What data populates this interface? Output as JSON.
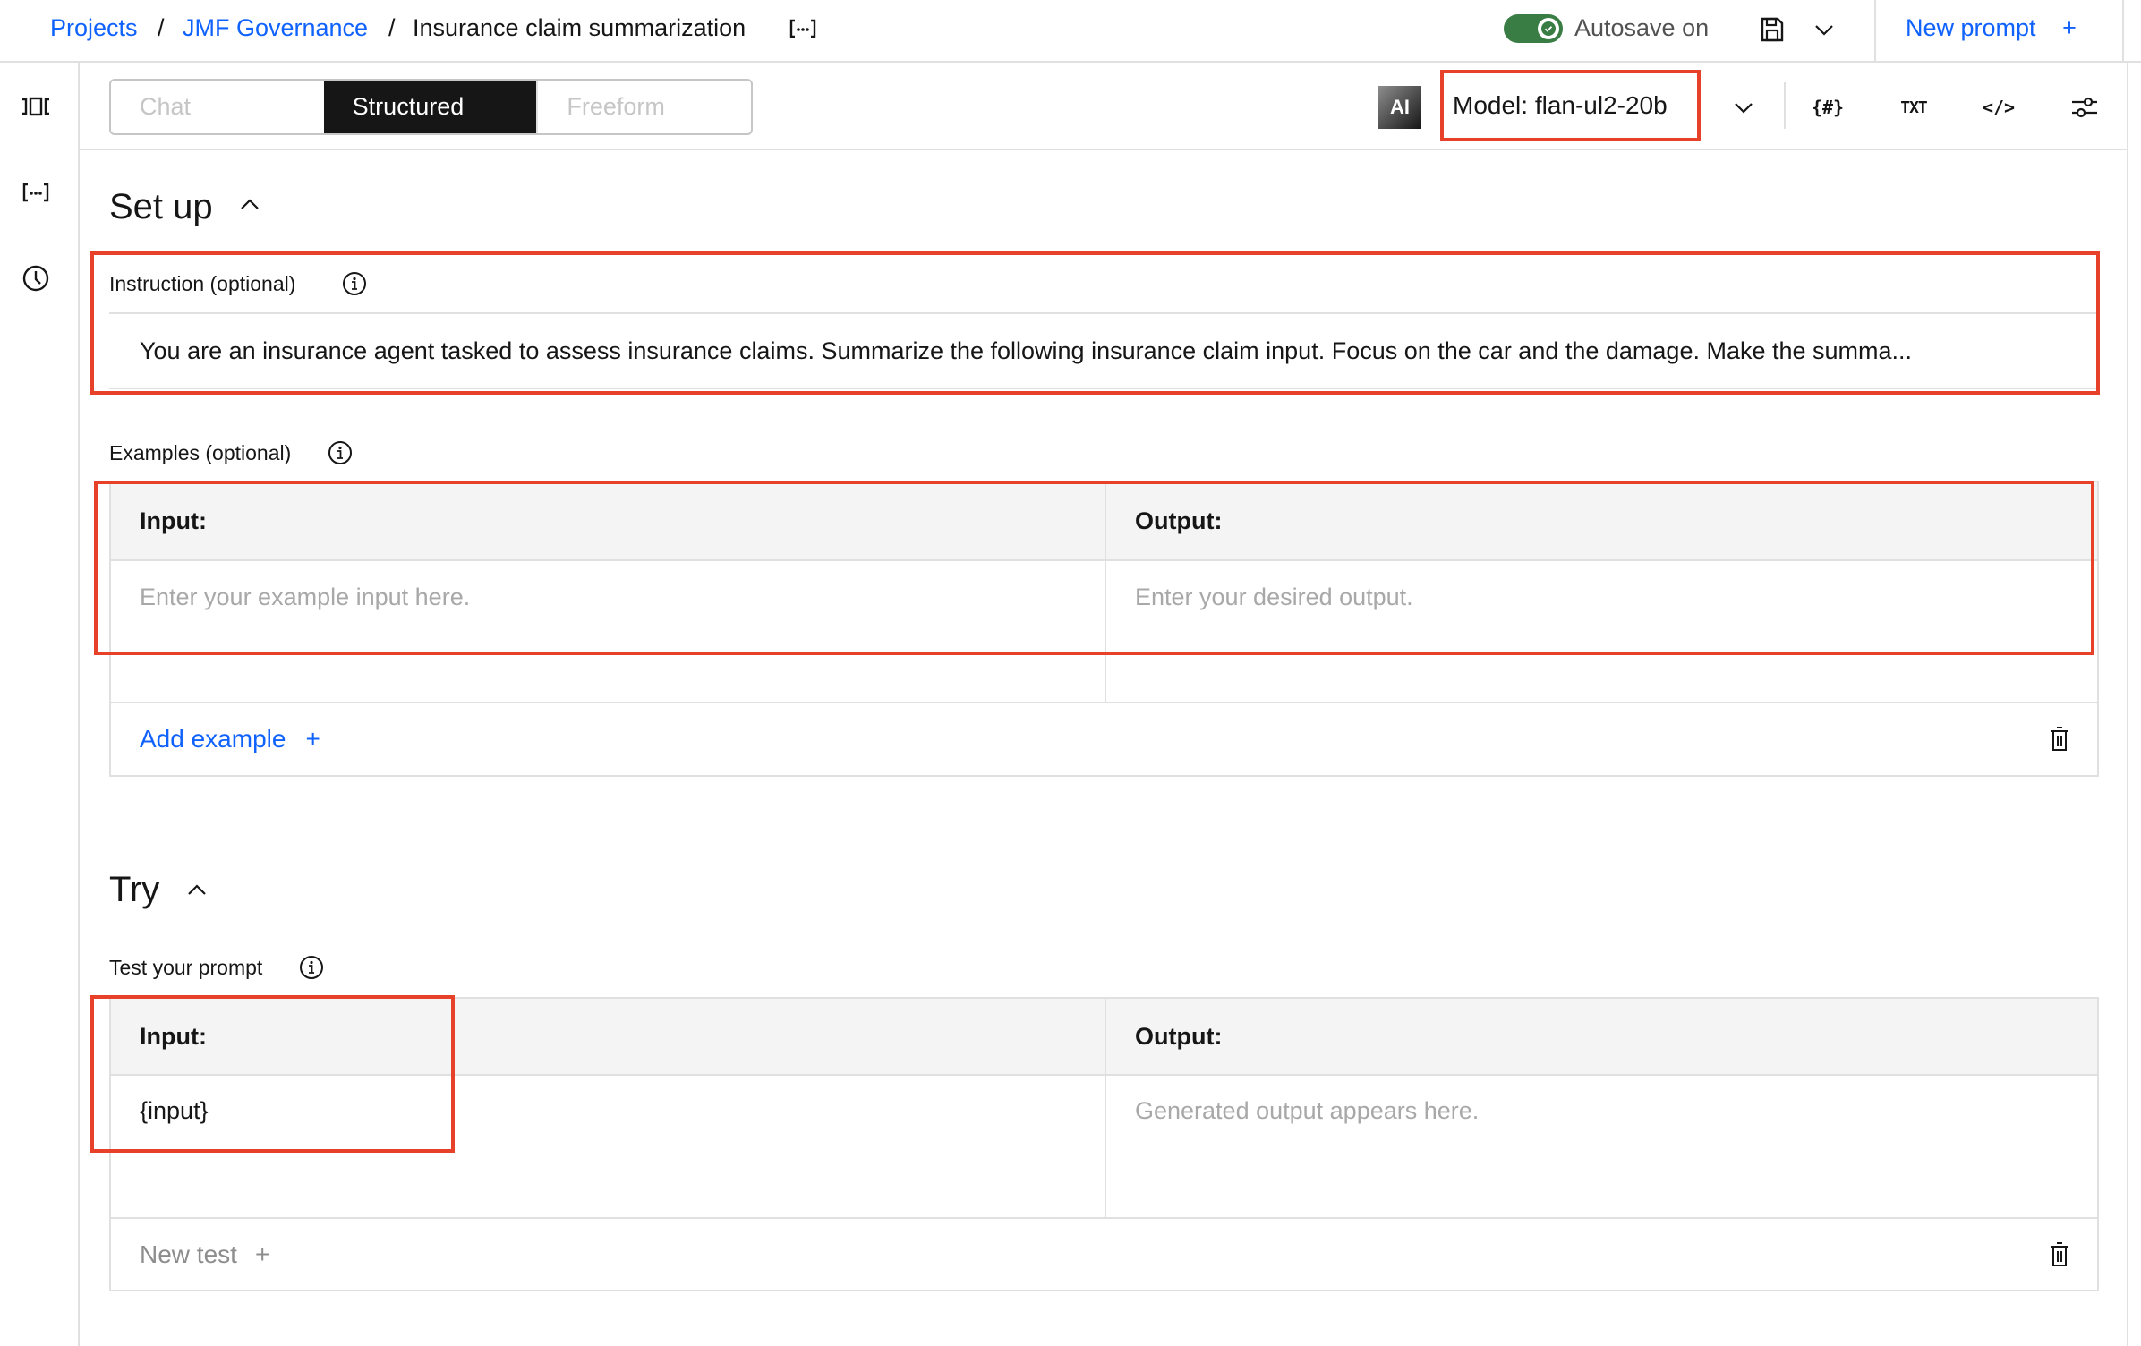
{
  "header": {
    "breadcrumb": [
      {
        "label": "Projects",
        "link": true
      },
      {
        "label": "JMF Governance",
        "link": true
      },
      {
        "label": "Insurance claim summarization",
        "link": false
      }
    ],
    "separator": "/",
    "prompt_asset_icon": "bracket-ellipsis-icon",
    "autosave": {
      "label": "Autosave on",
      "enabled": true
    },
    "save_icon": "save-icon",
    "new_prompt_label": "New prompt",
    "new_prompt_icon": "+"
  },
  "sidebar": {
    "items": [
      {
        "icon": "prompt-library-icon"
      },
      {
        "icon": "prompt-variables-icon"
      },
      {
        "icon": "history-icon"
      }
    ]
  },
  "toolbar": {
    "tabs": [
      {
        "label": "Chat",
        "active": false
      },
      {
        "label": "Structured",
        "active": true
      },
      {
        "label": "Freeform",
        "active": false
      }
    ],
    "ai_badge": "AI",
    "model_label": "Model: flan-ul2-20b",
    "icons": [
      {
        "name": "prompt-variables-icon",
        "glyph": "{#}"
      },
      {
        "name": "view-text-icon",
        "glyph": "TXT"
      },
      {
        "name": "view-code-icon",
        "glyph": "</>"
      },
      {
        "name": "model-parameters-icon",
        "glyph": ""
      }
    ]
  },
  "setup": {
    "title": "Set up",
    "instruction": {
      "label": "Instruction (optional)",
      "value": "You are an insurance agent tasked to assess insurance claims. Summarize the following insurance claim input. Focus on the car and the damage. Make the summa..."
    },
    "examples": {
      "label": "Examples (optional)",
      "input_header": "Input:",
      "output_header": "Output:",
      "input_placeholder": "Enter your example input here.",
      "output_placeholder": "Enter your desired output.",
      "add_label": "Add example",
      "add_icon": "+"
    }
  },
  "try": {
    "title": "Try",
    "label": "Test your prompt",
    "input_header": "Input:",
    "output_header": "Output:",
    "input_value": "{input}",
    "output_placeholder": "Generated output appears here.",
    "new_test_label": "New test",
    "new_test_icon": "+"
  },
  "colors": {
    "link": "#0f62fe",
    "toggle_on": "#3a7d44",
    "highlight": "#e8412a",
    "active_tab": "#161616"
  }
}
